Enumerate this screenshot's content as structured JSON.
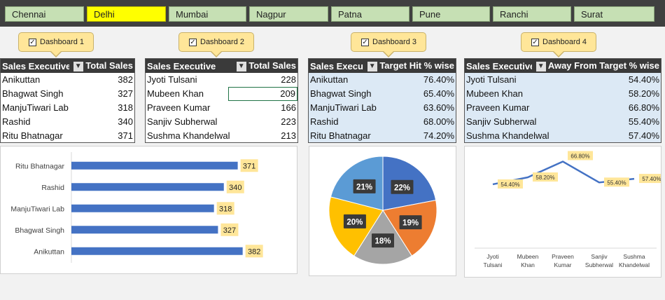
{
  "tabs": [
    "Chennai",
    "Delhi",
    "Mumbai",
    "Nagpur",
    "Patna",
    "Pune",
    "Ranchi",
    "Surat"
  ],
  "selected_tab": "Delhi",
  "dashboards": [
    {
      "label": "Dashboard 1",
      "checked": true
    },
    {
      "label": "Dashboard 2",
      "checked": true
    },
    {
      "label": "Dashboard 3",
      "checked": true
    },
    {
      "label": "Dashboard 4",
      "checked": true
    }
  ],
  "tables": [
    {
      "col1": "Sales Executive",
      "col2": "Total Sales",
      "rows": [
        [
          "Anikuttan",
          "382"
        ],
        [
          "Bhagwat Singh",
          "327"
        ],
        [
          "ManjuTiwari Lab",
          "318"
        ],
        [
          "Rashid",
          "340"
        ],
        [
          "Ritu Bhatnagar",
          "371"
        ]
      ]
    },
    {
      "col1": "Sales Executive",
      "col2": "Total Sales",
      "rows": [
        [
          "Jyoti Tulsani",
          "228"
        ],
        [
          "Mubeen Khan",
          "209"
        ],
        [
          "Praveen Kumar",
          "166"
        ],
        [
          "Sanjiv Subherwal",
          "223"
        ],
        [
          "Sushma Khandelwal",
          "213"
        ]
      ]
    },
    {
      "col1": "Sales Executive",
      "col2": "Target Hit % wise",
      "rows": [
        [
          "Anikuttan",
          "76.40%"
        ],
        [
          "Bhagwat Singh",
          "65.40%"
        ],
        [
          "ManjuTiwari Lab",
          "63.60%"
        ],
        [
          "Rashid",
          "68.00%"
        ],
        [
          "Ritu Bhatnagar",
          "74.20%"
        ]
      ]
    },
    {
      "col1": "Sales Executive",
      "col2": "Away From Target % wise",
      "rows": [
        [
          "Jyoti Tulsani",
          "54.40%"
        ],
        [
          "Mubeen Khan",
          "58.20%"
        ],
        [
          "Praveen Kumar",
          "66.80%"
        ],
        [
          "Sanjiv Subherwal",
          "55.40%"
        ],
        [
          "Sushma Khandelwal",
          "57.40%"
        ]
      ]
    }
  ],
  "chart_data": [
    {
      "type": "bar",
      "categories": [
        "Ritu Bhatnagar",
        "Rashid",
        "ManjuTiwari Lab",
        "Bhagwat Singh",
        "Anikuttan"
      ],
      "values": [
        371,
        340,
        318,
        327,
        382
      ],
      "xlim": [
        0,
        420
      ],
      "color": "#4472c4",
      "label_bg": "#ffe699"
    },
    {
      "type": "pie",
      "labels": [
        "22%",
        "19%",
        "18%",
        "20%",
        "21%"
      ],
      "values": [
        22,
        19,
        18,
        20,
        21
      ],
      "colors": [
        "#4472c4",
        "#ed7d31",
        "#a5a5a5",
        "#ffc000",
        "#5b9bd5"
      ]
    },
    {
      "type": "line",
      "categories": [
        "Jyoti Tulsani",
        "Mubeen Khan",
        "Praveen Kumar",
        "Sanjiv Subherwal",
        "Sushma Khandelwal"
      ],
      "values": [
        54.4,
        58.2,
        66.8,
        55.4,
        57.4
      ],
      "labels": [
        "54.40%",
        "58.20%",
        "66.80%",
        "55.40%",
        "57.40%"
      ],
      "ylim": [
        20,
        75
      ],
      "color": "#4472c4"
    }
  ]
}
